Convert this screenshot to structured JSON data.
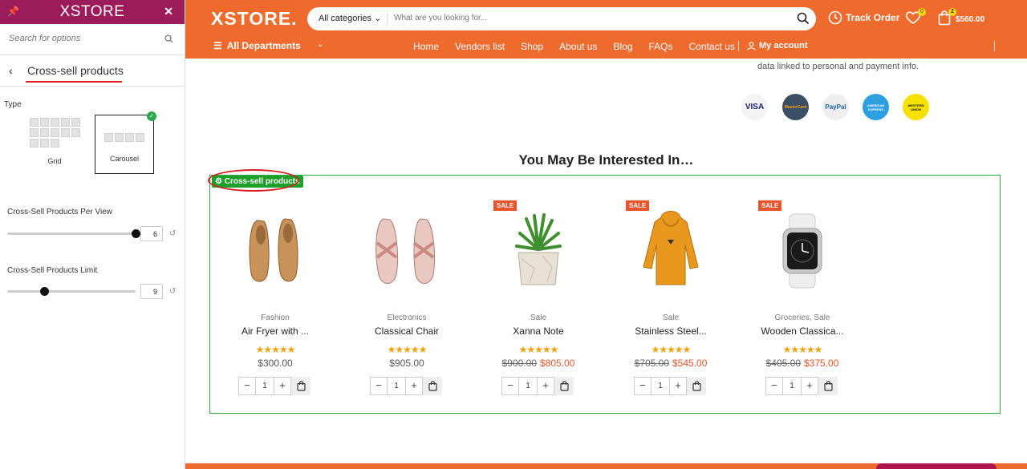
{
  "panel": {
    "logo": "XSTORE",
    "search_placeholder": "Search for options",
    "section_title": "Cross-sell products",
    "type_label": "Type",
    "options": [
      {
        "label": "Grid",
        "selected": false
      },
      {
        "label": "Carousel",
        "selected": true
      }
    ],
    "per_view_label": "Cross-Sell Products Per View",
    "per_view_value": "6",
    "per_view_level": 1.0,
    "limit_label": "Cross-Sell Products Limit",
    "limit_value": "9",
    "limit_level": 0.29
  },
  "header": {
    "brand": "XSTORE.",
    "search_category": "All categories",
    "search_placeholder": "What are you looking for...",
    "track_order": "Track Order",
    "wishlist_count": "0",
    "cart_count": "2",
    "cart_total": "$560.00",
    "departments": "All Departments",
    "nav": [
      "Home",
      "Vendors list",
      "Shop",
      "About us",
      "Blog",
      "FAQs",
      "Contact us"
    ],
    "account": "My account"
  },
  "content": {
    "info_text": "data linked to personal and payment info.",
    "payments": [
      "VISA",
      "MasterCard",
      "PayPal",
      "AMERICAN EXPRESS",
      "WESTERN UNION"
    ],
    "section_title": "You May Be Interested In…",
    "cross_sell_tag": "Cross-sell products",
    "products": [
      {
        "category": "Fashion",
        "name": "Air Fryer with ...",
        "stars": "★★★★★",
        "old_price": "",
        "price": "$300.00",
        "sale": "",
        "qty": "1",
        "image": "shoes-icon"
      },
      {
        "category": "Electronics",
        "name": "Classical Chair",
        "stars": "★★★★★",
        "old_price": "",
        "price": "$905.00",
        "sale": "",
        "qty": "1",
        "image": "sandals-icon"
      },
      {
        "category": "Sale",
        "name": "Xanna Note",
        "stars": "★★★★★",
        "old_price": "$900.00",
        "price": "$805.00",
        "sale": "SALE",
        "qty": "1",
        "image": "plant-icon"
      },
      {
        "category": "Sale",
        "name": "Stainless Steel...",
        "stars": "★★★★★",
        "old_price": "$705.00",
        "price": "$545.00",
        "sale": "SALE",
        "qty": "1",
        "image": "hoodie-icon"
      },
      {
        "category": "Groceries, Sale",
        "name": "Wooden Classica...",
        "stars": "★★★★★",
        "old_price": "$405.00",
        "price": "$375.00",
        "sale": "SALE",
        "qty": "1",
        "image": "watch-icon"
      }
    ]
  },
  "colors": {
    "brand_orange": "#ef6a2d",
    "panel_purple": "#9c1c5b",
    "accent_green": "#1da02a",
    "sale_red": "#e8542b"
  }
}
